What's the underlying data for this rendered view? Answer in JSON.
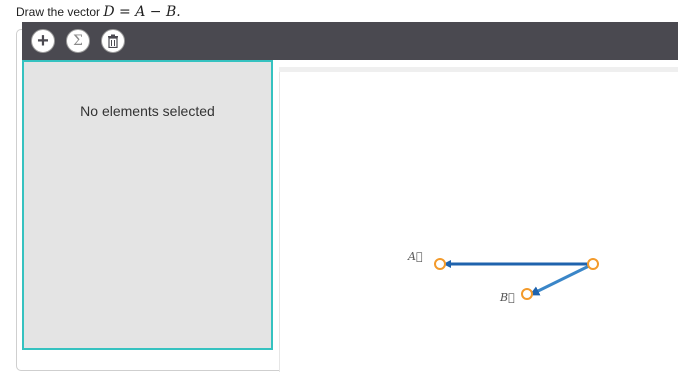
{
  "prompt": {
    "text": "Draw the vector",
    "equation": "D = A − B."
  },
  "toolbar": {
    "buttons": [
      {
        "name": "add",
        "icon": "plus-icon",
        "symbol": "+"
      },
      {
        "name": "sum",
        "icon": "sigma-icon",
        "symbol": "Σ"
      },
      {
        "name": "delete",
        "icon": "trash-icon"
      }
    ]
  },
  "side_panel": {
    "message": "No elements selected"
  },
  "vectors": {
    "a_label": "A⃗",
    "b_label": "B⃗"
  },
  "colors": {
    "toolbar": "#4a4950",
    "selection_border": "#35c2c0",
    "vector_a": "#1f63ad",
    "vector_b": "#3a86c8",
    "handle": "#f39a2b"
  }
}
